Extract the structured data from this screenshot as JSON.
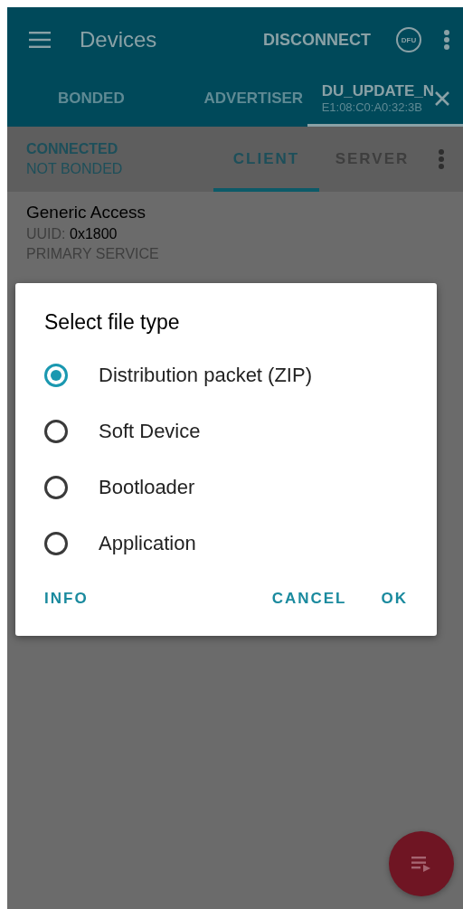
{
  "app_bar": {
    "title": "Devices",
    "action": "DISCONNECT",
    "dfu_label": "DFU"
  },
  "tabs": [
    {
      "label": "BONDED",
      "selected": false
    },
    {
      "label": "ADVERTISER",
      "selected": false
    },
    {
      "label": "DU_UPDATE_N",
      "subtitle": "E1:08:C0:A0:32:3B",
      "selected": true
    }
  ],
  "connection": {
    "status": "CONNECTED",
    "bond": "NOT BONDED"
  },
  "subtabs": [
    {
      "label": "CLIENT",
      "selected": true
    },
    {
      "label": "SERVER",
      "selected": false
    }
  ],
  "services": [
    {
      "name": "Generic Access",
      "uuid_label": "UUID:",
      "uuid": "0x1800",
      "type": "PRIMARY SERVICE"
    }
  ],
  "dialog": {
    "title": "Select file type",
    "options": [
      {
        "label": "Distribution packet (ZIP)",
        "selected": true
      },
      {
        "label": "Soft Device",
        "selected": false
      },
      {
        "label": "Bootloader",
        "selected": false
      },
      {
        "label": "Application",
        "selected": false
      }
    ],
    "buttons": [
      "INFO",
      "CANCEL",
      "OK"
    ]
  }
}
